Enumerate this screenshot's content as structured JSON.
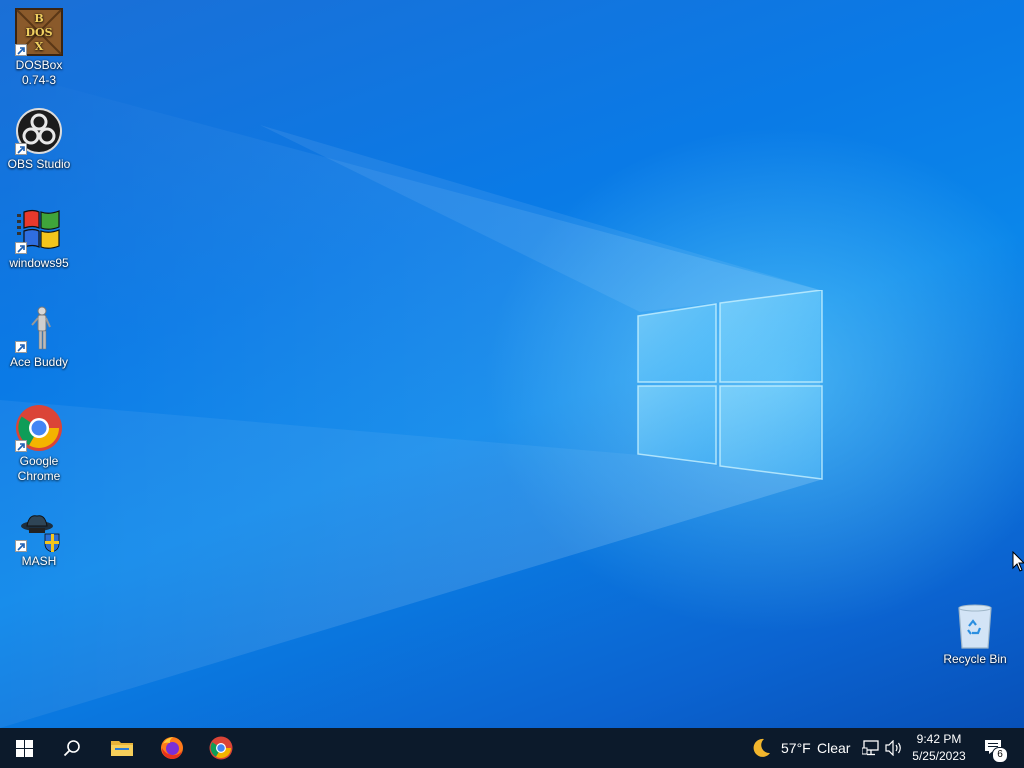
{
  "desktop": {
    "icons": [
      {
        "label": "DOSBox\n0.74-3",
        "icon": "dosbox-icon"
      },
      {
        "label": "OBS Studio",
        "icon": "obs-icon"
      },
      {
        "label": "windows95",
        "icon": "windows95-icon"
      },
      {
        "label": "Ace Buddy",
        "icon": "ace-buddy-icon"
      },
      {
        "label": "Google\nChrome",
        "icon": "chrome-icon"
      },
      {
        "label": "MASH",
        "icon": "mash-icon"
      }
    ],
    "recycle_bin": {
      "label": "Recycle Bin",
      "icon": "recycle-bin-icon"
    }
  },
  "taskbar": {
    "pinned": [
      {
        "name": "start",
        "icon": "windows-start-icon"
      },
      {
        "name": "search",
        "icon": "search-icon"
      },
      {
        "name": "file-explorer",
        "icon": "folder-icon"
      },
      {
        "name": "firefox",
        "icon": "firefox-icon"
      },
      {
        "name": "chrome",
        "icon": "chrome-icon"
      }
    ],
    "weather": {
      "temp": "57°F",
      "condition": "Clear",
      "icon": "moon-icon"
    },
    "clock": {
      "time": "9:42 PM",
      "date": "5/25/2023"
    },
    "notifications": {
      "count": "6",
      "icon": "action-center-icon"
    }
  },
  "colors": {
    "wallpaper_blue": "#0a86ea",
    "taskbar": "#0c1a2b"
  }
}
